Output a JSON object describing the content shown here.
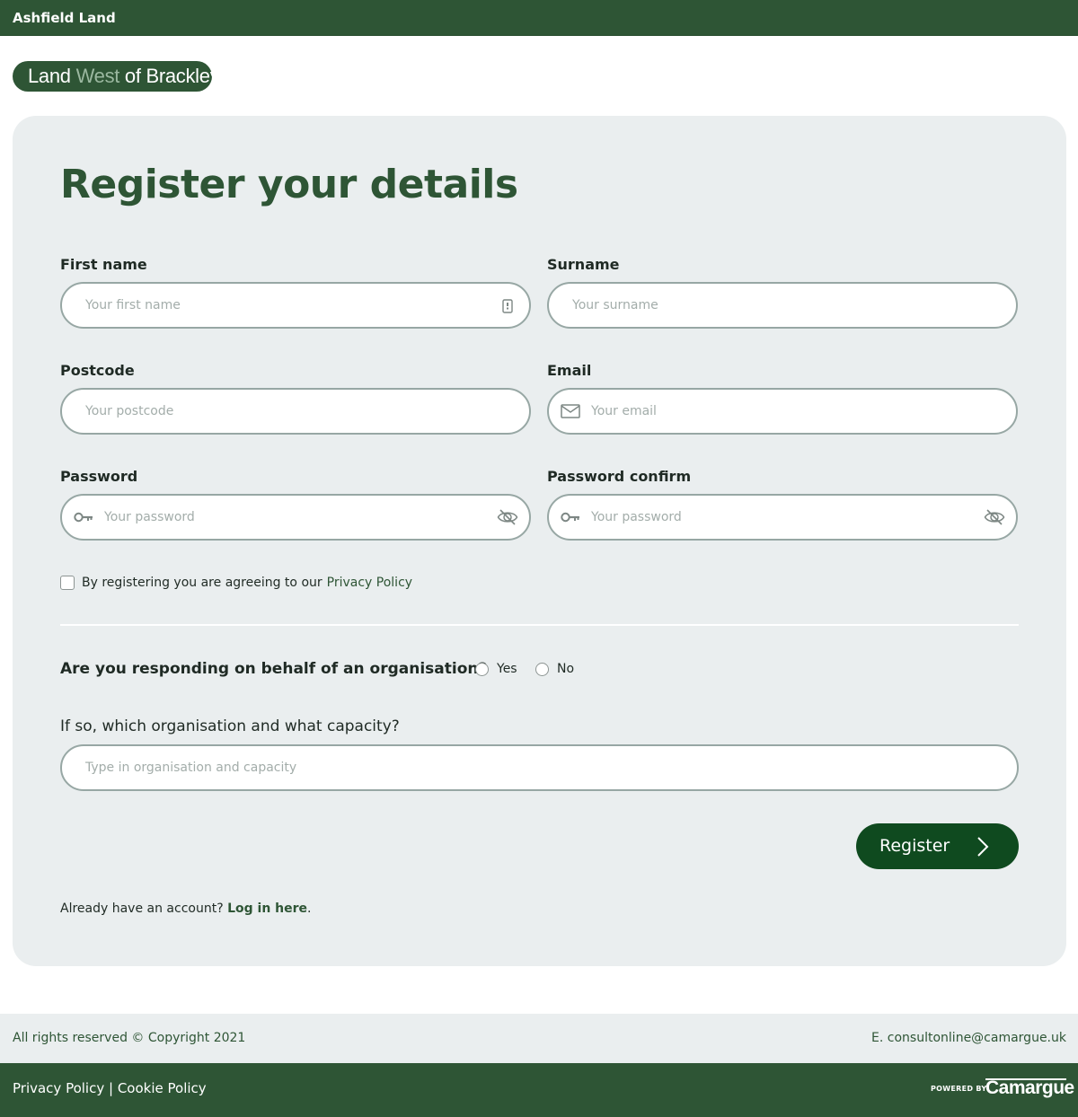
{
  "topbar": {
    "brand": "Ashfield Land"
  },
  "logo": {
    "part1": "Land ",
    "part2": "West",
    "part3": " of Brackley"
  },
  "form": {
    "title": "Register your details",
    "first_name": {
      "label": "First name",
      "placeholder": "Your first name",
      "value": ""
    },
    "surname": {
      "label": "Surname",
      "placeholder": "Your surname",
      "value": ""
    },
    "postcode": {
      "label": "Postcode",
      "placeholder": "Your postcode",
      "value": ""
    },
    "email": {
      "label": "Email",
      "placeholder": "Your email",
      "value": ""
    },
    "password": {
      "label": "Password",
      "placeholder": "Your password",
      "value": ""
    },
    "password_confirm": {
      "label": "Password confirm",
      "placeholder": "Your password",
      "value": ""
    },
    "privacy": {
      "text": "By registering you are agreeing to our",
      "link": "Privacy Policy",
      "checked": false
    },
    "organisation_question": {
      "label": "Are you responding on behalf of an organisation?",
      "yes": "Yes",
      "no": "No"
    },
    "organisation_capacity": {
      "label": "If so, which organisation and what capacity?",
      "placeholder": "Type in organisation and capacity",
      "value": ""
    },
    "register_label": "Register",
    "login": {
      "text": "Already have an account?",
      "link": "Log in here",
      "suffix": "."
    }
  },
  "footer": {
    "copyright": "All rights reserved © Copyright 2021",
    "email": "E. consultonline@camargue.uk",
    "privacy_link": "Privacy Policy",
    "separator": " | ",
    "cookie_link": "Cookie Policy",
    "powered_by": "POWERED BY",
    "camargue": "Camargue"
  },
  "colors": {
    "brand_green": "#2e5535",
    "button_green": "#0f4a1f",
    "card_bg": "#eaeeef"
  },
  "icons": {
    "first_name": "contact-card-icon",
    "email": "envelope-icon",
    "password_key": "key-icon",
    "password_toggle": "eye-slash-icon",
    "register": "chevron-right-icon"
  }
}
